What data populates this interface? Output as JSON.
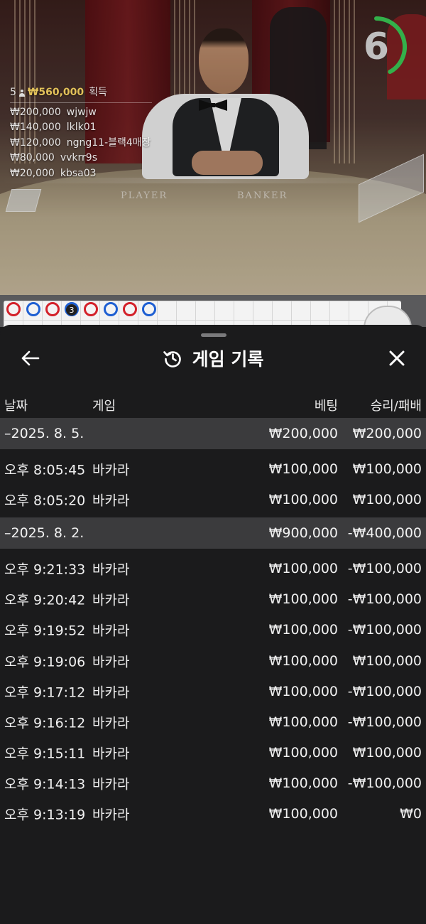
{
  "timer": {
    "seconds": "6",
    "progress": 0.42,
    "ring_color": "#33b04a"
  },
  "winners": {
    "count": "5",
    "total": "₩560,000",
    "suffix": "획득",
    "list": [
      {
        "amount": "₩200,000",
        "user": "wjwjw"
      },
      {
        "amount": "₩140,000",
        "user": "lklk01"
      },
      {
        "amount": "₩120,000",
        "user": "ngng11-블랙4매장"
      },
      {
        "amount": "₩80,000",
        "user": "vvkrr9s"
      },
      {
        "amount": "₩20,000",
        "user": "kbsa03"
      }
    ]
  },
  "table_labels": {
    "player": "PLAYER",
    "banker": "BANKER"
  },
  "road": {
    "badge": "3",
    "beads": [
      "red",
      "blue",
      "red",
      "blue",
      "red",
      "blue",
      "red",
      "blue"
    ]
  },
  "sheet": {
    "title": "게임 기록",
    "back_icon": "arrow-left-icon",
    "history_icon": "history-icon",
    "close_icon": "close-icon"
  },
  "columns": {
    "date": "날짜",
    "game": "게임",
    "bet": "베팅",
    "win_loss": "승리/패배"
  },
  "days": [
    {
      "date": "–2025. 8. 5.",
      "bet": "₩200,000",
      "result": "₩200,000",
      "records": [
        {
          "time": "오후 8:05:45",
          "game": "바카라",
          "bet": "₩100,000",
          "result": "₩100,000"
        },
        {
          "time": "오후 8:05:20",
          "game": "바카라",
          "bet": "₩100,000",
          "result": "₩100,000"
        }
      ]
    },
    {
      "date": "–2025. 8. 2.",
      "bet": "₩900,000",
      "result": "-₩400,000",
      "records": [
        {
          "time": "오후 9:21:33",
          "game": "바카라",
          "bet": "₩100,000",
          "result": "-₩100,000"
        },
        {
          "time": "오후 9:20:42",
          "game": "바카라",
          "bet": "₩100,000",
          "result": "-₩100,000"
        },
        {
          "time": "오후 9:19:52",
          "game": "바카라",
          "bet": "₩100,000",
          "result": "-₩100,000"
        },
        {
          "time": "오후 9:19:06",
          "game": "바카라",
          "bet": "₩100,000",
          "result": "₩100,000"
        },
        {
          "time": "오후 9:17:12",
          "game": "바카라",
          "bet": "₩100,000",
          "result": "-₩100,000"
        },
        {
          "time": "오후 9:16:12",
          "game": "바카라",
          "bet": "₩100,000",
          "result": "-₩100,000"
        },
        {
          "time": "오후 9:15:11",
          "game": "바카라",
          "bet": "₩100,000",
          "result": "₩100,000"
        },
        {
          "time": "오후 9:14:13",
          "game": "바카라",
          "bet": "₩100,000",
          "result": "-₩100,000"
        },
        {
          "time": "오후 9:13:19",
          "game": "바카라",
          "bet": "₩100,000",
          "result": "₩0"
        }
      ]
    }
  ]
}
